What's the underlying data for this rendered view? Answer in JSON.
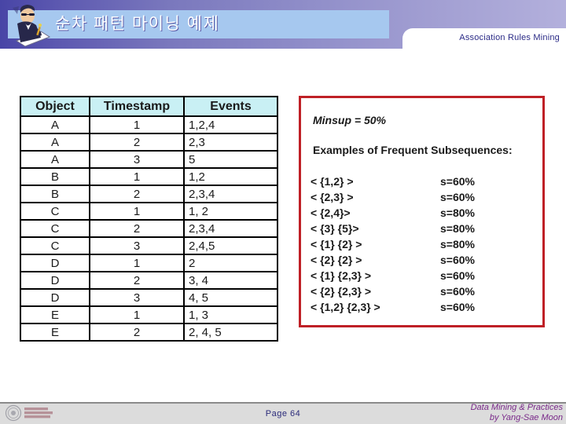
{
  "header": {
    "title": "순차 패턴 마이닝 예제",
    "topic_label": "Association Rules Mining",
    "clip_icon": "person-writing-icon",
    "plate_color": "#a6c8ef",
    "band_color_start": "#4845a6",
    "band_color_end": "#b3b0dc"
  },
  "table": {
    "columns": [
      "Object",
      "Timestamp",
      "Events"
    ],
    "header_bg": "#c9f0f4",
    "rows": [
      [
        "A",
        "1",
        "1,2,4"
      ],
      [
        "A",
        "2",
        "2,3"
      ],
      [
        "A",
        "3",
        "5"
      ],
      [
        "B",
        "1",
        "1,2"
      ],
      [
        "B",
        "2",
        "2,3,4"
      ],
      [
        "C",
        "1",
        "1, 2"
      ],
      [
        "C",
        "2",
        "2,3,4"
      ],
      [
        "C",
        "3",
        "2,4,5"
      ],
      [
        "D",
        "1",
        "2"
      ],
      [
        "D",
        "2",
        "3, 4"
      ],
      [
        "D",
        "3",
        "4, 5"
      ],
      [
        "E",
        "1",
        "1, 3"
      ],
      [
        "E",
        "2",
        "2, 4, 5"
      ]
    ]
  },
  "panel": {
    "border_color": "#bf2026",
    "minsup": "Minsup = 50%",
    "examples_title": "Examples of Frequent Subsequences:",
    "sequences": [
      {
        "pattern": "< {1,2} >",
        "support": "s=60%"
      },
      {
        "pattern": "< {2,3} >",
        "support": "s=60%"
      },
      {
        "pattern": "< {2,4}>",
        "support": "s=80%"
      },
      {
        "pattern": "< {3} {5}>",
        "support": "s=80%"
      },
      {
        "pattern": "< {1} {2} >",
        "support": "s=80%"
      },
      {
        "pattern": "< {2} {2} >",
        "support": "s=60%"
      },
      {
        "pattern": "< {1} {2,3} >",
        "support": "s=60%"
      },
      {
        "pattern": "< {2} {2,3} >",
        "support": "s=60%"
      },
      {
        "pattern": "< {1,2} {2,3} >",
        "support": "s=60%"
      }
    ]
  },
  "footer": {
    "logo_icon": "university-seal-icon",
    "page_label": "Page 64",
    "credit_line1": "Data Mining & Practices",
    "credit_line2": "by Yang-Sae Moon",
    "band_color": "#dcdcdc",
    "page_color": "#2b2b7a",
    "credit_color": "#7a2a8a"
  }
}
